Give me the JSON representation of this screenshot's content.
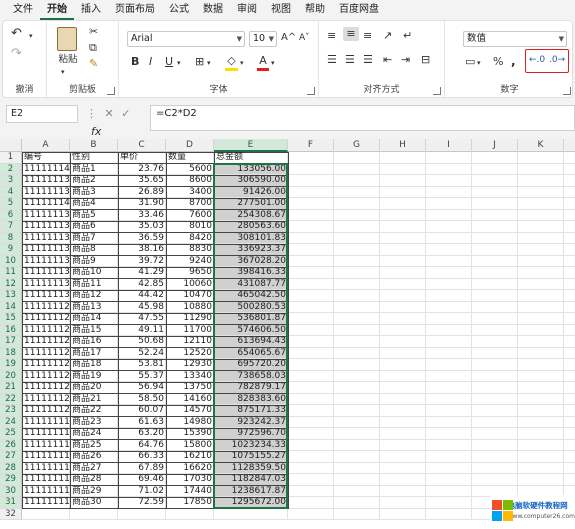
{
  "menu": {
    "tabs": [
      "文件",
      "开始",
      "插入",
      "页面布局",
      "公式",
      "数据",
      "审阅",
      "视图",
      "帮助",
      "百度网盘"
    ],
    "active": "开始"
  },
  "ribbon": {
    "undo_label": "撤消",
    "clipboard": {
      "paste_label": "粘贴",
      "group_label": "剪贴板"
    },
    "font": {
      "font_name": "Arial",
      "font_size": "10",
      "group_label": "字体",
      "bold": "B",
      "italic": "I",
      "underline": "U",
      "color_letter": "A",
      "grow": "A^",
      "shrink": "Aˇ"
    },
    "alignment": {
      "group_label": "对齐方式"
    },
    "number": {
      "format": "数值",
      "group_label": "数字"
    },
    "accent_color": "#217346",
    "highlight_color": "#e02020"
  },
  "formula_bar": {
    "name_box": "E2",
    "fx": "fx",
    "formula": "=C2*D2"
  },
  "sheet": {
    "columns": [
      "A",
      "B",
      "C",
      "D",
      "E",
      "F",
      "G",
      "H",
      "I",
      "J",
      "K"
    ],
    "rows": [
      "1",
      "2",
      "3",
      "4",
      "5",
      "6",
      "7",
      "8",
      "9",
      "10",
      "11",
      "12",
      "13",
      "14",
      "15",
      "16",
      "17",
      "18",
      "19",
      "20",
      "21",
      "22",
      "23",
      "24",
      "25",
      "26",
      "27",
      "28",
      "29",
      "30",
      "31",
      "32"
    ],
    "headers": [
      "编号",
      "性别",
      "单价",
      "数量",
      "总金额"
    ],
    "data": [
      [
        "111111140",
        "商品1",
        "23.76",
        "5600",
        "133056.00"
      ],
      [
        "111111139",
        "商品2",
        "35.65",
        "8600",
        "306590.00"
      ],
      [
        "111111133",
        "商品3",
        "26.89",
        "3400",
        "91426.00"
      ],
      [
        "111111141",
        "商品4",
        "31.90",
        "8700",
        "277501.00"
      ],
      [
        "111111138",
        "商品5",
        "33.46",
        "7600",
        "254308.67"
      ],
      [
        "111111137",
        "商品6",
        "35.03",
        "8010",
        "280563.60"
      ],
      [
        "111111136",
        "商品7",
        "36.59",
        "8420",
        "308101.83"
      ],
      [
        "111111135",
        "商品8",
        "38.16",
        "8830",
        "336923.37"
      ],
      [
        "111111134",
        "商品9",
        "39.72",
        "9240",
        "367028.20"
      ],
      [
        "111111132",
        "商品10",
        "41.29",
        "9650",
        "398416.33"
      ],
      [
        "111111131",
        "商品11",
        "42.85",
        "10060",
        "431087.77"
      ],
      [
        "111111130",
        "商品12",
        "44.42",
        "10470",
        "465042.50"
      ],
      [
        "111111129",
        "商品13",
        "45.98",
        "10880",
        "500280.53"
      ],
      [
        "111111128",
        "商品14",
        "47.55",
        "11290",
        "536801.87"
      ],
      [
        "111111127",
        "商品15",
        "49.11",
        "11700",
        "574606.50"
      ],
      [
        "111111126",
        "商品16",
        "50.68",
        "12110",
        "613694.43"
      ],
      [
        "111111125",
        "商品17",
        "52.24",
        "12520",
        "654065.67"
      ],
      [
        "111111124",
        "商品18",
        "53.81",
        "12930",
        "695720.20"
      ],
      [
        "111111123",
        "商品19",
        "55.37",
        "13340",
        "738658.03"
      ],
      [
        "111111122",
        "商品20",
        "56.94",
        "13750",
        "782879.17"
      ],
      [
        "111111121",
        "商品21",
        "58.50",
        "14160",
        "828383.60"
      ],
      [
        "111111120",
        "商品22",
        "60.07",
        "14570",
        "875171.33"
      ],
      [
        "111111119",
        "商品23",
        "61.63",
        "14980",
        "923242.37"
      ],
      [
        "111111118",
        "商品24",
        "63.20",
        "15390",
        "972596.70"
      ],
      [
        "111111117",
        "商品25",
        "64.76",
        "15800",
        "1023234.33"
      ],
      [
        "111111116",
        "商品26",
        "66.33",
        "16210",
        "1075155.27"
      ],
      [
        "111111115",
        "商品27",
        "67.89",
        "16620",
        "1128359.50"
      ],
      [
        "111111114",
        "商品28",
        "69.46",
        "17030",
        "1182847.03"
      ],
      [
        "111111113",
        "商品29",
        "71.02",
        "17440",
        "1238617.87"
      ],
      [
        "111111112",
        "商品30",
        "72.59",
        "17850",
        "1295672.00"
      ]
    ]
  },
  "watermark": {
    "title": "电脑软硬件教程网",
    "url": "www.computer26.com"
  }
}
